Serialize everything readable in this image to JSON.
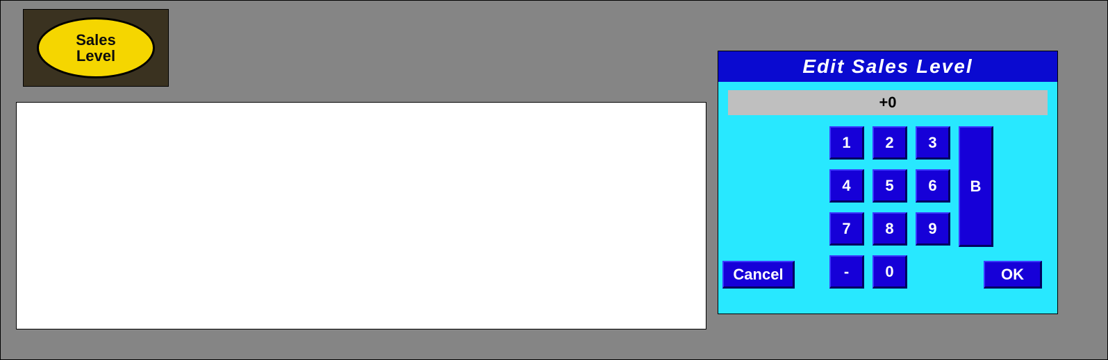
{
  "oval_button": {
    "line1": "Sales",
    "line2": "Level"
  },
  "keypad": {
    "title": "Edit Sales Level",
    "display": "+0",
    "keys": {
      "k1": "1",
      "k2": "2",
      "k3": "3",
      "k4": "4",
      "k5": "5",
      "k6": "6",
      "k7": "7",
      "k8": "8",
      "k9": "9",
      "k0": "0",
      "kminus": "-",
      "kB": "B",
      "cancel": "Cancel",
      "ok": "OK"
    }
  }
}
